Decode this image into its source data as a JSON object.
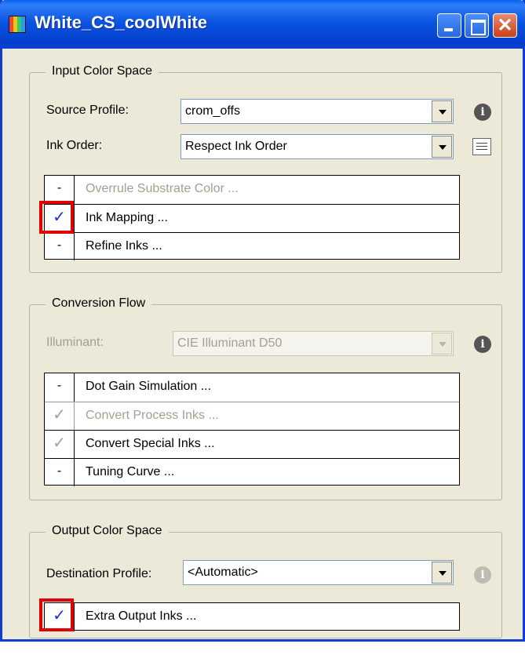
{
  "window": {
    "title": "White_CS_coolWhite"
  },
  "input_color_space": {
    "legend": "Input Color Space",
    "source_profile": {
      "label": "Source Profile:",
      "value": "crom_offs"
    },
    "ink_order": {
      "label": "Ink Order:",
      "value": "Respect Ink Order"
    },
    "rows": [
      {
        "flag": "-",
        "label": "Overrule Substrate Color ...",
        "enabled": false
      },
      {
        "flag": "✓",
        "label": "Ink Mapping ...",
        "enabled": true
      },
      {
        "flag": "-",
        "label": "Refine Inks ...",
        "enabled": true
      }
    ]
  },
  "conversion_flow": {
    "legend": "Conversion Flow",
    "illuminant": {
      "label": "Illuminant:",
      "value": "CIE Illuminant D50"
    },
    "rows": [
      {
        "flag": "-",
        "label": "Dot Gain Simulation ...",
        "enabled": true
      },
      {
        "flag": "✓",
        "label": "Convert Process Inks ...",
        "enabled": false
      },
      {
        "flag": "✓",
        "label": "Convert Special Inks ...",
        "enabled": true
      },
      {
        "flag": "-",
        "label": "Tuning Curve ...",
        "enabled": true
      }
    ]
  },
  "output_color_space": {
    "legend": "Output Color Space",
    "destination_profile": {
      "label": "Destination Profile:",
      "value": "<Automatic>"
    },
    "rows": [
      {
        "flag": "✓",
        "label": "Extra Output Inks ...",
        "enabled": true
      }
    ]
  },
  "icons": {
    "info": "i",
    "close": "✕"
  },
  "colors": {
    "highlight": "#e00000",
    "check": "#1e2ccf",
    "titlebar": "#0a54e3"
  }
}
